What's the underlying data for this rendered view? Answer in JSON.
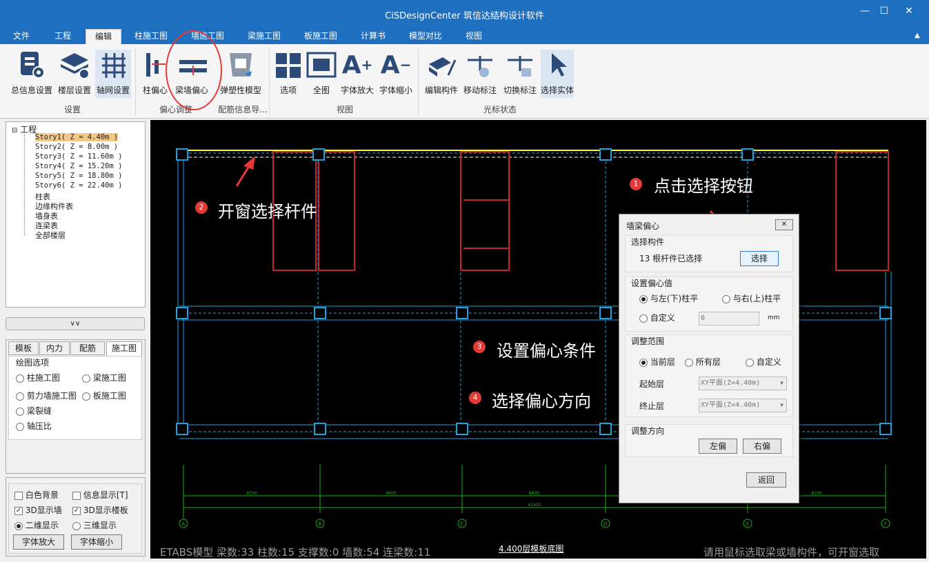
{
  "window": {
    "title": "CiSDesignCenter 筑信达结构设计软件"
  },
  "menu_tabs": [
    "文件",
    "工程",
    "编辑",
    "柱施工图",
    "墙施工图",
    "梁施工图",
    "板施工图",
    "计算书",
    "模型对比",
    "视图"
  ],
  "ribbon": {
    "buttons": [
      "总信息设置",
      "楼层设置",
      "轴网设置",
      "柱偏心",
      "梁墙偏心",
      "弹塑性模型",
      "选项",
      "全图",
      "字体放大",
      "字体缩小",
      "编辑构件",
      "移动标注",
      "切换标注",
      "选择实体"
    ],
    "groups": [
      "设置",
      "偏心调整",
      "配筋信息导...",
      "视图",
      "光标状态"
    ]
  },
  "tree": {
    "root": "工程",
    "items": [
      "Story1( Z = 4.40m )",
      "Story2( Z = 8.00m )",
      "Story3( Z = 11.60m )",
      "Story4( Z = 15.20m )",
      "Story5( Z = 18.80m )",
      "Story6( Z = 22.40m )",
      "柱表",
      "边缘构件表",
      "墙身表",
      "连梁表",
      "全部楼层"
    ]
  },
  "panel": {
    "tabs": [
      "模板",
      "内力",
      "配筋",
      "施工图"
    ],
    "group_title": "绘图选项",
    "options": [
      "柱施工图",
      "梁施工图",
      "剪力墙施工图",
      "板施工图",
      "梁裂缝",
      "轴压比"
    ]
  },
  "display": {
    "checks": [
      "白色背景",
      "信息显示[T]",
      "3D显示墙",
      "3D显示楼板"
    ],
    "modes": [
      "二维显示",
      "三维显示"
    ],
    "zoom_in": "字体放大",
    "zoom_out": "字体缩小"
  },
  "dialog": {
    "title": "墙梁偏心",
    "select_group": "选择构件",
    "selected_text": "13 根杆件已选择",
    "select_button": "选择",
    "offset_group": "设置偏心值",
    "opt_left": "与左(下)柱平",
    "opt_right": "与右(上)柱平",
    "opt_custom": "自定义",
    "custom_value": "0",
    "unit": "mm",
    "range_group": "调整范围",
    "range_current": "当前层",
    "range_all": "所有层",
    "range_custom": "自定义",
    "start_label": "起始层",
    "start_value": "XY平面(Z=4.40m)",
    "end_label": "终止层",
    "end_value": "XY平面(Z=4.40m)",
    "dir_group": "调整方向",
    "left_button": "左偏",
    "right_button": "右偏",
    "back_button": "返回"
  },
  "annotations": [
    {
      "num": "1",
      "text": "点击选择按钮"
    },
    {
      "num": "2",
      "text": "开窗选择杆件"
    },
    {
      "num": "3",
      "text": "设置偏心条件"
    },
    {
      "num": "4",
      "text": "选择偏心方向"
    }
  ],
  "drawing": {
    "axis_labels": [
      "A",
      "B",
      "C",
      "D",
      "E",
      "F"
    ],
    "dims": [
      "8700",
      "8400",
      "8400",
      "8400",
      "8100"
    ],
    "total_dim": "41400",
    "floor_label": "4.400层模板底图"
  },
  "status": {
    "left": "ETABS模型  梁数:33 柱数:15 支撑数:0 墙数:54 连梁数:11",
    "right": "请用鼠标选取梁或墙构件，可开窗选取"
  },
  "colors": {
    "titlebar": "#1e6fbf",
    "canvas": "#000000",
    "beam_yellow": "#ffff00",
    "wall_red": "#c8242a",
    "column_cyan": "#1aa3e0",
    "accent_red": "#e53935"
  }
}
